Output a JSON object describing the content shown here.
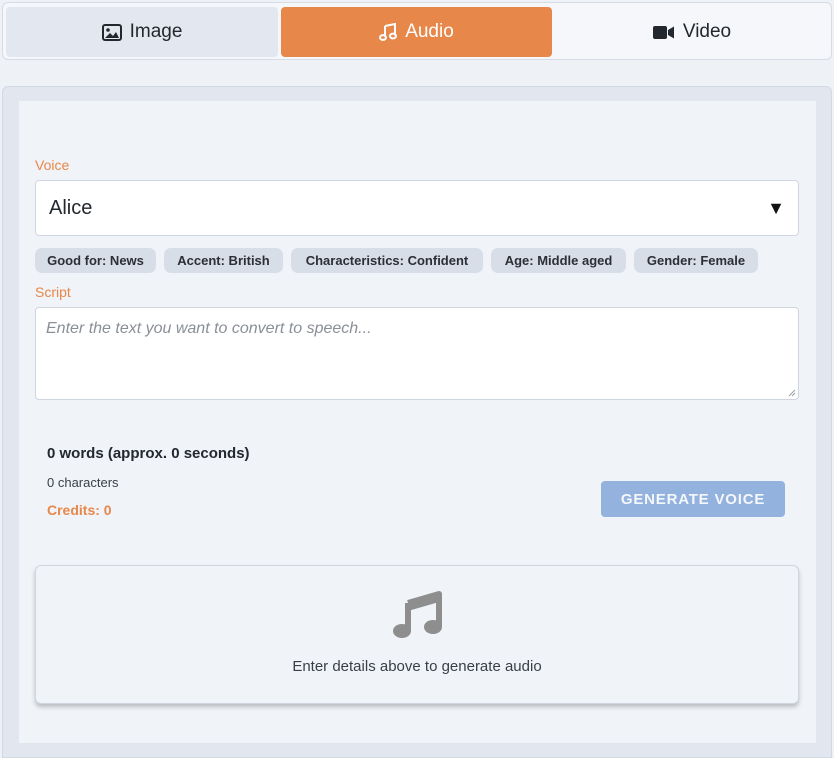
{
  "tabs": {
    "image": {
      "label": "Image",
      "icon": "image-icon"
    },
    "audio": {
      "label": "Audio",
      "icon": "music-note-icon",
      "active": true
    },
    "video": {
      "label": "Video",
      "icon": "video-camera-icon"
    }
  },
  "form": {
    "voice_label": "Voice",
    "voice_value": "Alice",
    "voice_arrow": "▼",
    "tags": [
      "Good for: News",
      "Accent: British",
      "Characteristics: Confident",
      "Age: Middle aged",
      "Gender: Female"
    ],
    "script_label": "Script",
    "script_placeholder": "Enter the text you want to convert to speech...",
    "word_count": "0 words (approx. 0 seconds)",
    "char_count": "0 characters",
    "credits": "Credits: 0",
    "generate_label": "GENERATE VOICE"
  },
  "result": {
    "icon": "music-note-icon",
    "message": "Enter details above to generate audio"
  },
  "colors": {
    "accent": "#e8874a",
    "button_disabled": "#93b2dd"
  }
}
